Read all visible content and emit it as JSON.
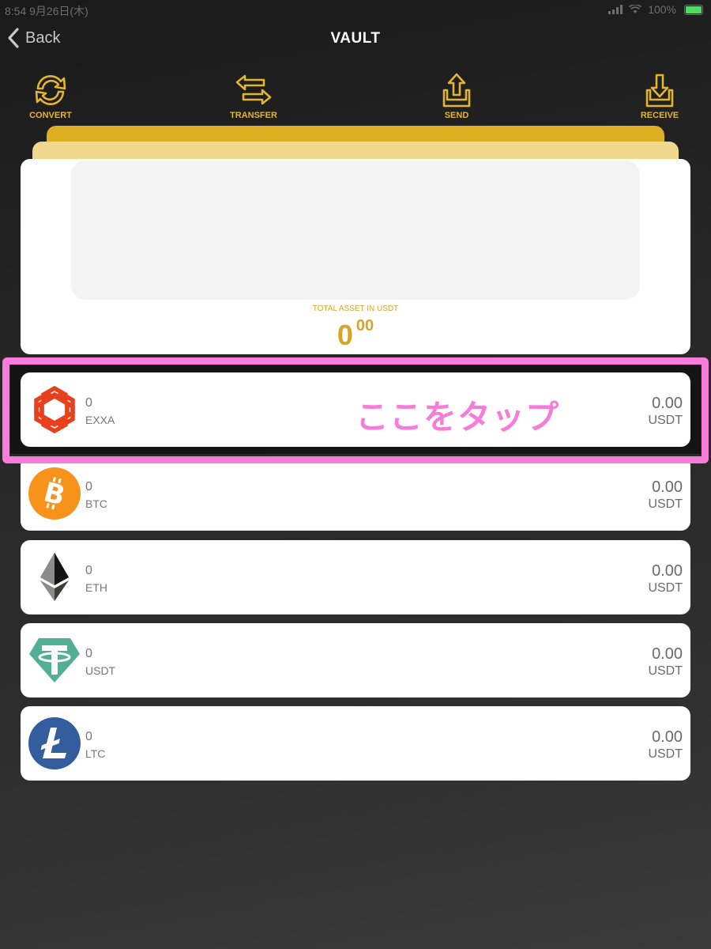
{
  "status_bar": {
    "time": "8:54",
    "date": "9月26日(木)",
    "battery": "100%"
  },
  "nav": {
    "back_label": "Back",
    "title": "VAULT"
  },
  "actions": [
    {
      "label": "CONVERT",
      "icon": "convert-icon"
    },
    {
      "label": "TRANSFER",
      "icon": "transfer-icon"
    },
    {
      "label": "SEND",
      "icon": "send-icon"
    },
    {
      "label": "RECEIVE",
      "icon": "receive-icon"
    }
  ],
  "total": {
    "label": "TOTAL ASSET IN USDT",
    "integer": "0",
    "decimal": "00"
  },
  "coins": [
    {
      "amount": "0",
      "symbol": "EXXA",
      "value": "0.00",
      "unit": "USDT",
      "icon": "exxa-icon"
    },
    {
      "amount": "0",
      "symbol": "BTC",
      "value": "0.00",
      "unit": "USDT",
      "icon": "bitcoin-icon"
    },
    {
      "amount": "0",
      "symbol": "ETH",
      "value": "0.00",
      "unit": "USDT",
      "icon": "ethereum-icon"
    },
    {
      "amount": "0",
      "symbol": "USDT",
      "value": "0.00",
      "unit": "USDT",
      "icon": "tether-icon"
    },
    {
      "amount": "0",
      "symbol": "LTC",
      "value": "0.00",
      "unit": "USDT",
      "icon": "litecoin-icon"
    }
  ],
  "annotation": {
    "text": "ここをタップ"
  },
  "colors": {
    "accent": "#e1b530",
    "highlight": "#f87ddb",
    "bitcoin": "#f7931a",
    "tether": "#50af95",
    "litecoin": "#345d9d",
    "exxa": "#e8401c"
  }
}
